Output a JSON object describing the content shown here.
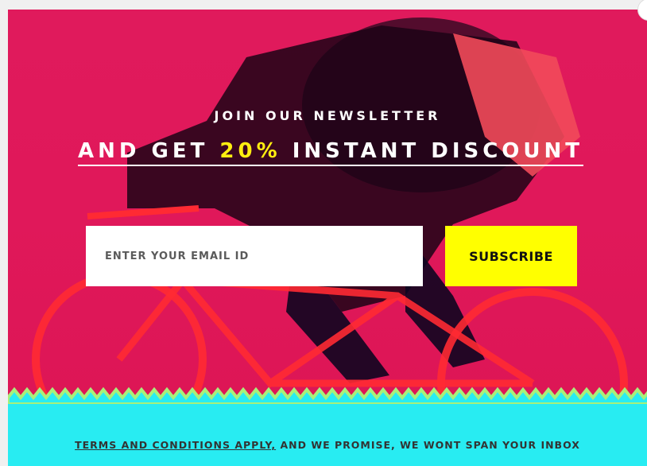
{
  "newsletter": {
    "heading_small": "JOIN OUR NEWSLETTER",
    "heading_big_prefix": "AND GET ",
    "heading_big_highlight": "20%",
    "heading_big_suffix": " INSTANT DISCOUNT",
    "email_placeholder": "ENTER YOUR EMAIL ID",
    "subscribe_label": "SUBSCRIBE"
  },
  "footer": {
    "terms_link": "TERMS AND CONDITIONS APPLY,",
    "promise_text": " AND WE PROMISE, WE WONT SPAN YOUR INBOX"
  },
  "colors": {
    "background": "#e41b5e",
    "highlight": "#ffee10",
    "button": "#ffff00",
    "footer": "#28ecf2",
    "zigzag": "#a8f07a"
  },
  "icons": {
    "close": "close-icon"
  }
}
